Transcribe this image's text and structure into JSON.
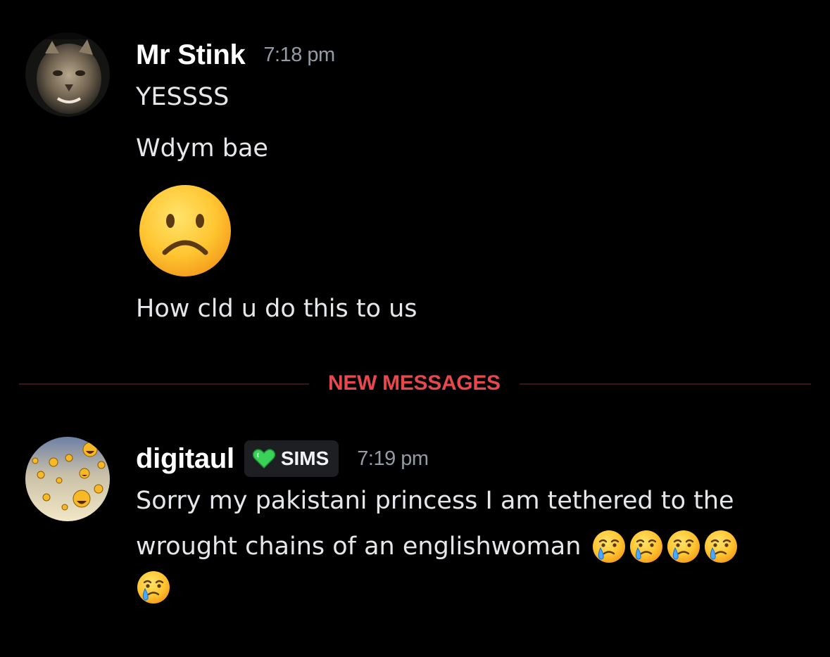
{
  "messages_top": {
    "author": "Mr Stink",
    "time": "7:18 pm",
    "lines": [
      "YESSSS",
      "Wdym bae",
      "How cld u do this to us"
    ],
    "big_emoji": "slightly-frowning-face-icon"
  },
  "divider": {
    "label": "NEW MESSAGES",
    "color": "#e5484d"
  },
  "messages_bottom": {
    "author": "digitaul",
    "clan_tag": "SIMS",
    "time": "7:19 pm",
    "line1": "Sorry my pakistani princess I am tethered to the",
    "line2": "wrought chains of an englishwoman",
    "trailing_emoji": "face-holding-back-tears-icon",
    "trailing_emoji_count": 5
  },
  "colors": {
    "background": "#000000",
    "timestamp": "#949ba4",
    "clan_tag_bg": "#1e1f22",
    "clan_heart": "#3ad35a"
  }
}
